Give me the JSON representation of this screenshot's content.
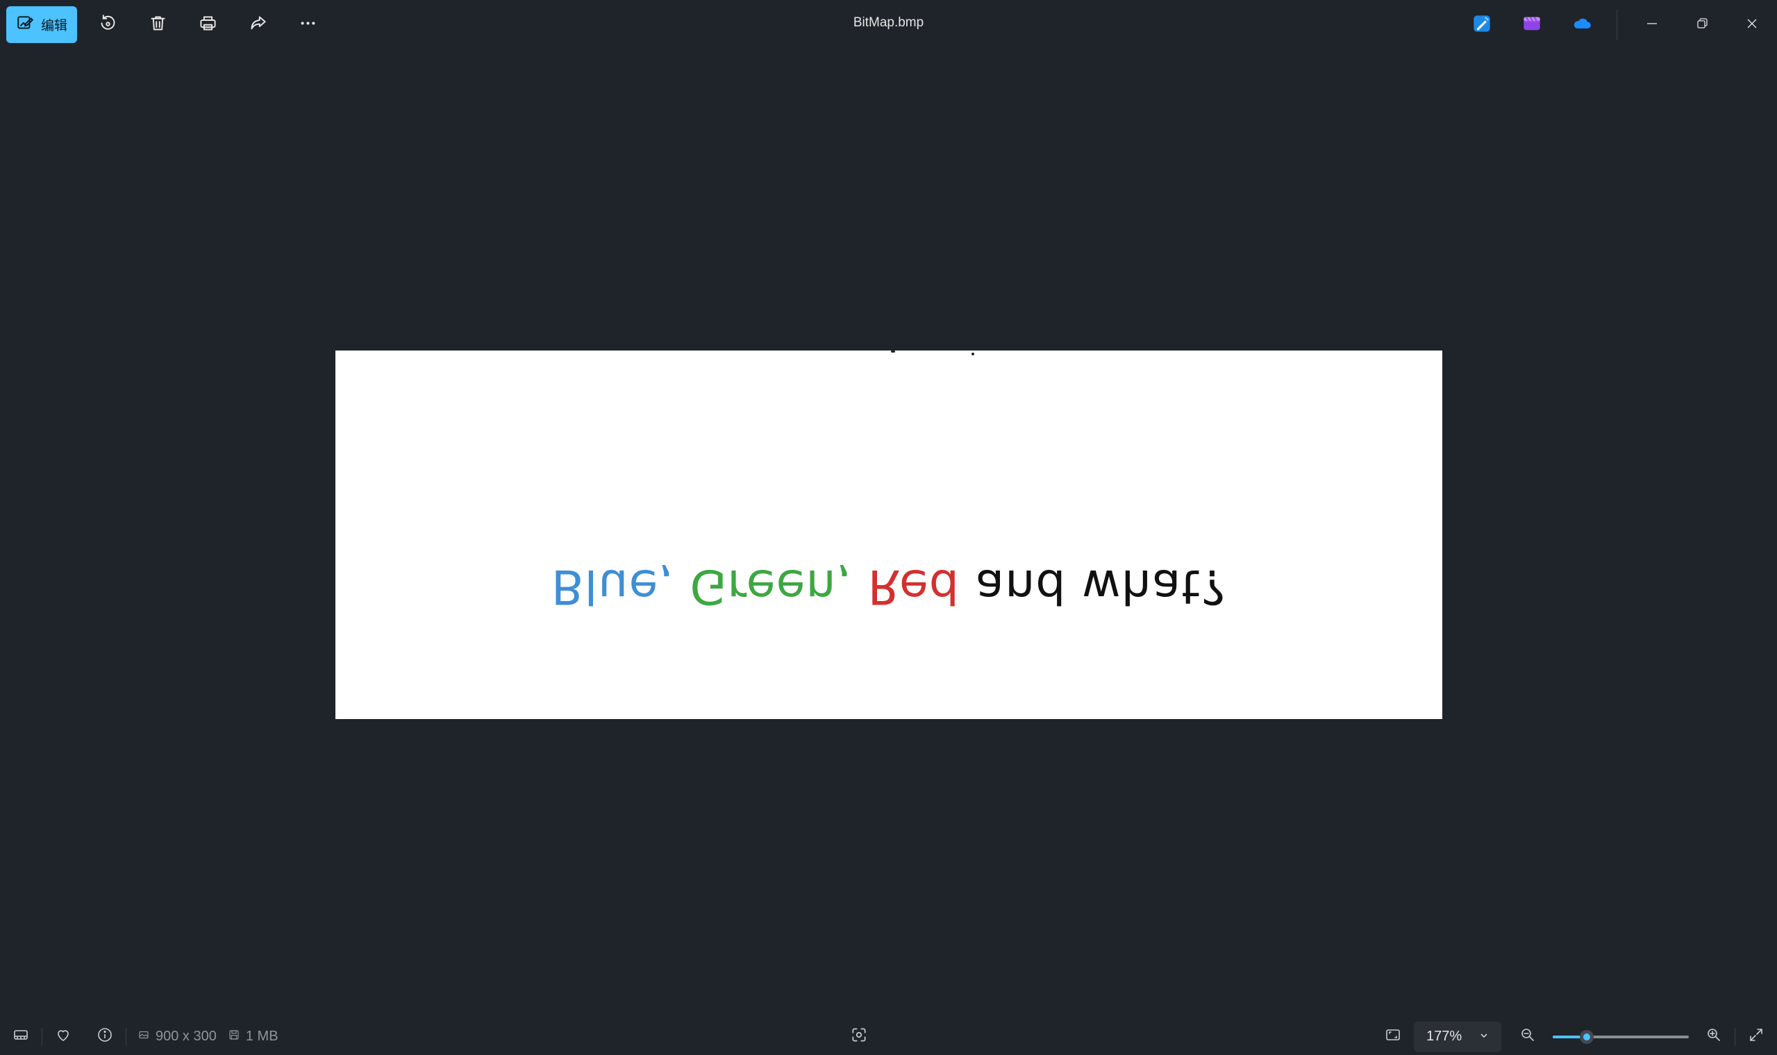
{
  "toolbar": {
    "edit_label": "编辑",
    "buttons": [
      "rotate-icon",
      "delete-icon",
      "print-icon",
      "share-icon",
      "more-icon"
    ]
  },
  "window": {
    "title": "BitMap.bmp"
  },
  "image": {
    "words": [
      {
        "text": "Blue,",
        "color": "#3d8fd6"
      },
      {
        "text": "Green,",
        "color": "#3da742"
      },
      {
        "text": "Red",
        "color": "#d3302f"
      },
      {
        "text": "and what?",
        "color": "#111111"
      }
    ],
    "orientation": "upside-down"
  },
  "status": {
    "dimensions": "900 x 300",
    "size": "1 MB",
    "zoom": "177%",
    "zoom_level_fraction": 0.22
  },
  "colors": {
    "accent": "#4cc2ff",
    "background": "#1f232a"
  }
}
